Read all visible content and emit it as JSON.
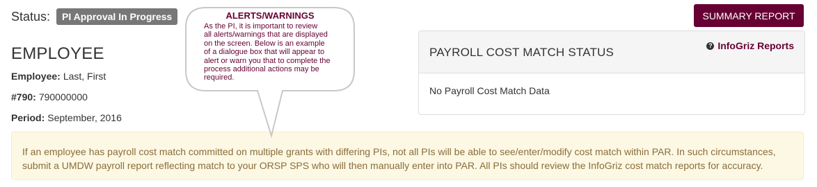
{
  "status": {
    "label": "Status:",
    "badge": "PI Approval In Progress"
  },
  "employee": {
    "heading": "EMPLOYEE",
    "employee_label": "Employee:",
    "employee_value": "Last, First",
    "id_label": "#790:",
    "id_value": "790000000",
    "period_label": "Period:",
    "period_value": "September, 2016"
  },
  "summary_button": "SUMMARY REPORT",
  "payroll_panel": {
    "title": "PAYROLL COST MATCH STATUS",
    "report_link": "InfoGriz Reports",
    "report_icon": "question-circle-icon",
    "body": "No Payroll Cost Match Data"
  },
  "alert": {
    "line1": "If an employee has payroll cost match committed on multiple grants with differing PIs, not all PIs will be able to see/enter/modify cost match within PAR. In such circumstances,",
    "line2": "submit a UMDW payroll report reflecting match to your ORSP SPS who will then manually enter into PAR. All PIs should review the InfoGriz cost match reports for accuracy."
  },
  "callout": {
    "title": "ALERTS/WARNINGS",
    "lines": [
      "As the PI, it is important to review",
      "all alerts/warnings that are displayed",
      "on the screen. Below is an example",
      "of a dialogue box that will appear to",
      "alert or warn you that to complete the",
      "process additional actions may be",
      "required."
    ]
  },
  "colors": {
    "brand": "#660033",
    "badge": "#777777",
    "alert_bg": "#fcf8e3",
    "alert_text": "#8a6d3b"
  }
}
